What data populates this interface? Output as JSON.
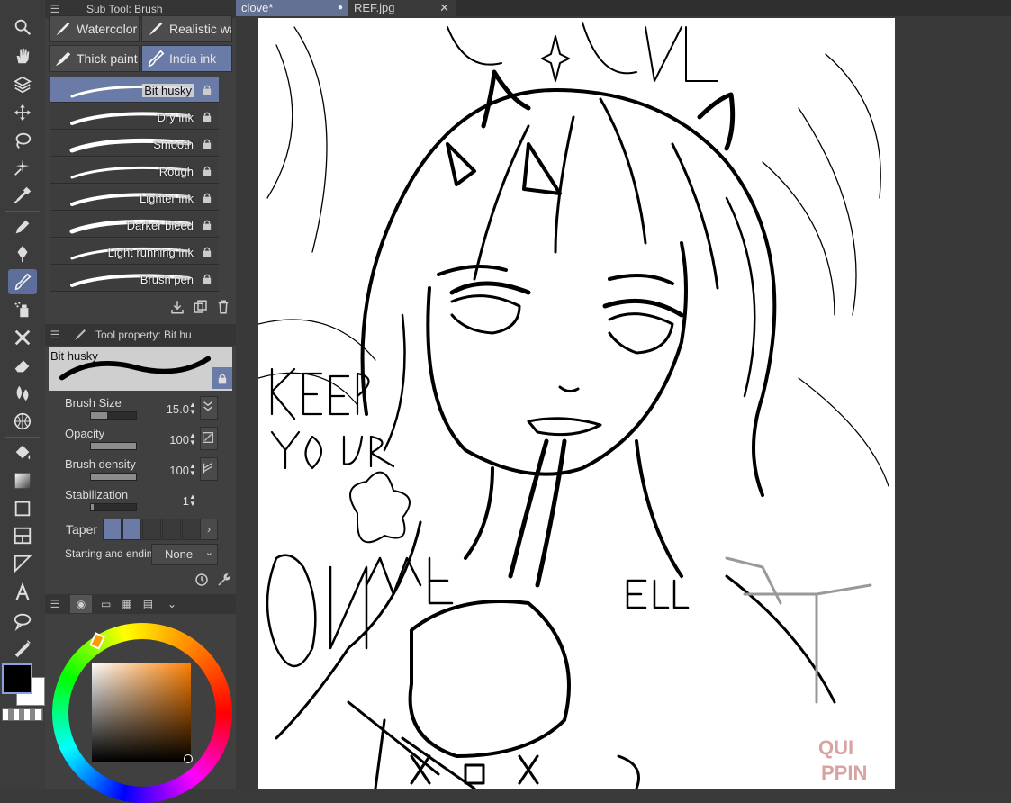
{
  "tabs": [
    {
      "label": "clove*",
      "close": "●"
    },
    {
      "label": "REF.jpg",
      "close": "✕"
    }
  ],
  "subtool_panel": {
    "title": "Sub Tool: Brush",
    "groups": [
      "Watercolor",
      "Realistic wa",
      "Thick paint",
      "India ink"
    ],
    "active_group": "India ink",
    "brushes": [
      "Bit husky",
      "Dry ink",
      "Smooth",
      "Rough",
      "Lighter ink",
      "Darker bleed",
      "Light running ink",
      "Brush pen"
    ],
    "active_brush": "Bit husky"
  },
  "tool_property": {
    "title": "Tool property: Bit hu",
    "preview_label": "Bit husky",
    "rows": [
      {
        "label": "Brush Size",
        "value": "15.0",
        "fill": 0.35
      },
      {
        "label": "Opacity",
        "value": "100",
        "fill": 1.0
      },
      {
        "label": "Brush density",
        "value": "100",
        "fill": 1.0
      },
      {
        "label": "Stabilization",
        "value": "1",
        "fill": 0.05
      },
      {
        "label": "Taper",
        "value": ""
      },
      {
        "label": "Starting and ending",
        "value": "None"
      }
    ]
  },
  "colors": {
    "accent": "#6a7ba8",
    "main_color": "#000000",
    "sub_color": "#ffffff"
  },
  "watermark": "QUI PPIN",
  "icons": [
    "pen-tool-icon",
    "zoom-icon",
    "hand-icon",
    "rotate-icon",
    "move-icon",
    "lasso-icon",
    "magic-wand-icon",
    "eyedropper-icon",
    "pencil-icon",
    "pen-icon",
    "brush-icon",
    "airbrush-icon",
    "decoration-icon",
    "eraser-icon",
    "blend-icon",
    "figure-icon",
    "fill-icon",
    "gradient-icon",
    "rectangle-icon",
    "frame-icon",
    "ruler-icon",
    "text-icon",
    "balloon-icon",
    "correction-icon"
  ]
}
